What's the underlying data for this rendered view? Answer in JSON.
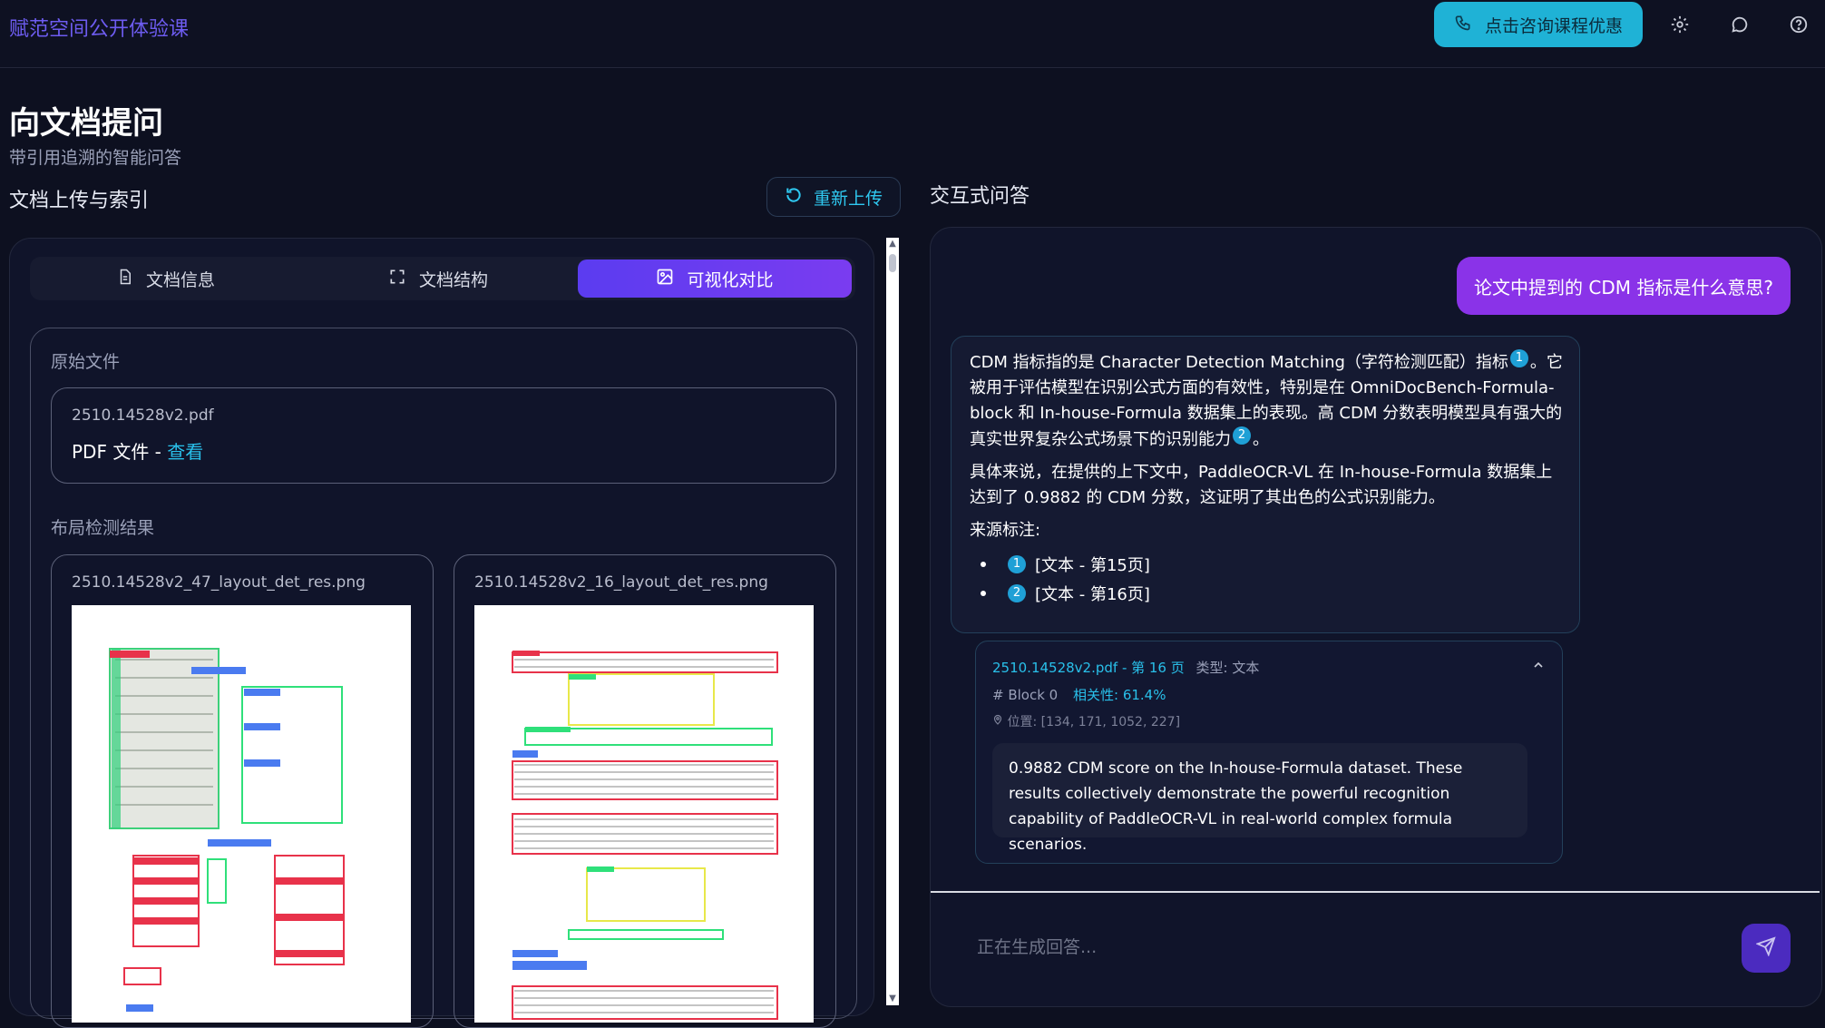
{
  "app": {
    "title": "赋范空间公开体验课"
  },
  "header": {
    "consult_label": "点击咨询课程优惠"
  },
  "page": {
    "title": "向文档提问",
    "subtitle": "带引用追溯的智能问答"
  },
  "left": {
    "section_title": "文档上传与索引",
    "reupload_label": "重新上传",
    "tabs": [
      {
        "label": "文档信息",
        "icon": "document-icon"
      },
      {
        "label": "文档结构",
        "icon": "expand-icon"
      },
      {
        "label": "可视化对比",
        "icon": "image-icon",
        "active": true
      }
    ],
    "original_label": "原始文件",
    "file": {
      "name": "2510.14528v2.pdf",
      "type_label": "PDF 文件 - ",
      "view_link": "查看"
    },
    "layout_label": "布局检测结果",
    "layout_images": [
      {
        "title": "2510.14528v2_47_layout_det_res.png"
      },
      {
        "title": "2510.14528v2_16_layout_det_res.png"
      }
    ]
  },
  "right": {
    "section_title": "交互式问答",
    "question": "论文中提到的 CDM 指标是什么意思?",
    "answer": {
      "p1a": "CDM 指标指的是 Character Detection Matching（字符检测匹配）指标",
      "p1b": "。它被用于评估模型在识别公式方面的有效性，特别是在 OmniDocBench-Formula-block 和 In-house-Formula 数据集上的表现。高 CDM 分数表明模型具有强大的真实世界复杂公式场景下的识别能力",
      "p1c": "。",
      "cite1": "1",
      "cite2": "2",
      "p2": "具体来说，在提供的上下文中，PaddleOCR-VL 在 In-house-Formula 数据集上达到了 0.9882 的 CDM 分数，这证明了其出色的公式识别能力。",
      "sources_label": "来源标注:",
      "sources": [
        {
          "num": "1",
          "text": "[文本 - 第15页]"
        },
        {
          "num": "2",
          "text": "[文本 - 第16页]"
        }
      ]
    },
    "source_card": {
      "title": "2510.14528v2.pdf - 第 16 页",
      "type": "类型: 文本",
      "block": "# Block 0",
      "relevance": "相关性: 61.4%",
      "position": "位置: [134, 171, 1052, 227]",
      "text": "0.9882 CDM score on the In-house-Formula dataset. These results collectively demonstrate the powerful recognition capability of PaddleOCR-VL in real-world complex formula scenarios."
    },
    "input_placeholder": "正在生成回答..."
  },
  "colors": {
    "accent": "#7a3cf0",
    "cyan": "#1fb2d6",
    "link": "#29c0ea",
    "background": "#0d1020"
  }
}
